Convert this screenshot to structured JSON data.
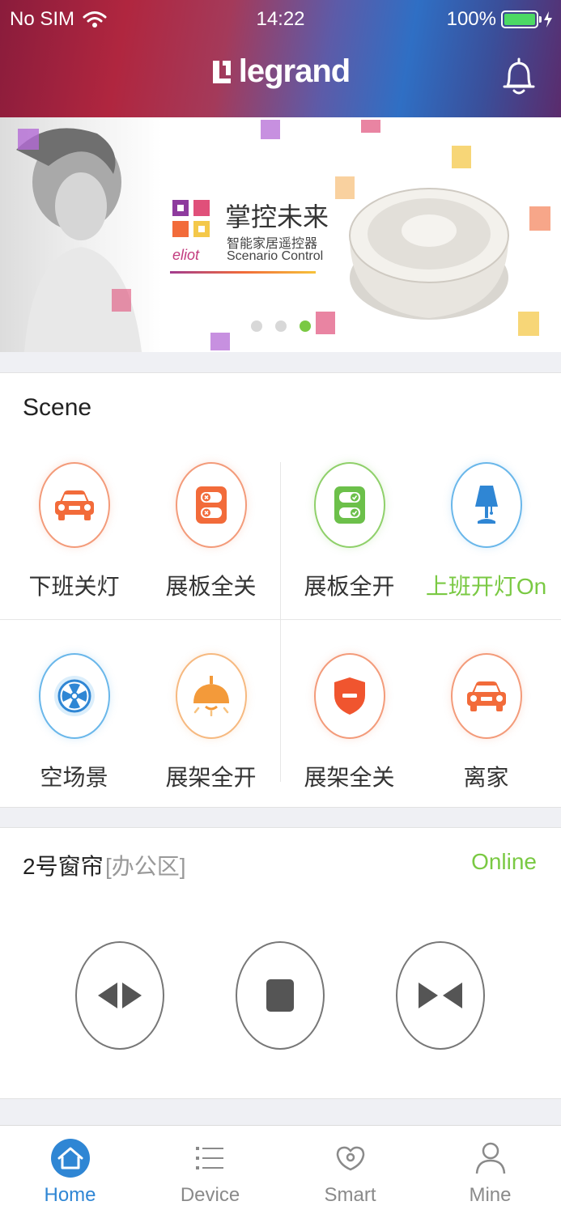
{
  "status_bar": {
    "carrier": "No SIM",
    "time": "14:22",
    "battery": "100%"
  },
  "header": {
    "brand": "legrand"
  },
  "banner": {
    "title_zh": "掌控未来",
    "subtitle_zh": "智能家居遥控器",
    "subtitle_en": "Scenario Control",
    "product_brand": "eliot",
    "pages": 3,
    "active_page": 3
  },
  "scene": {
    "title": "Scene",
    "items": [
      {
        "label": "下班关灯",
        "icon": "car-icon",
        "color": "#f26b3a"
      },
      {
        "label": "展板全关",
        "icon": "switch-panel-off-icon",
        "color": "#f26b3a"
      },
      {
        "label": "展板全开",
        "icon": "switch-panel-on-icon",
        "color": "#6cc04a"
      },
      {
        "label": "上班开灯On",
        "icon": "lamp-icon",
        "color": "#2f86d4",
        "active": true
      },
      {
        "label": "空场景",
        "icon": "fan-icon",
        "color": "#2f86d4"
      },
      {
        "label": "展架全开",
        "icon": "ceiling-light-icon",
        "color": "#f39a3a"
      },
      {
        "label": "展架全关",
        "icon": "shield-icon",
        "color": "#f0552f"
      },
      {
        "label": "离家",
        "icon": "car-icon",
        "color": "#f26b3a"
      }
    ]
  },
  "curtain": {
    "name": "2号窗帘",
    "area": "[办公区]",
    "status": "Online",
    "controls": [
      "open-icon",
      "stop-icon",
      "close-icon"
    ]
  },
  "tabs": [
    {
      "label": "Home",
      "icon": "home-icon",
      "active": true
    },
    {
      "label": "Device",
      "icon": "list-icon"
    },
    {
      "label": "Smart",
      "icon": "smart-icon"
    },
    {
      "label": "Mine",
      "icon": "person-icon"
    }
  ],
  "colors": {
    "accent_green": "#7ac943",
    "accent_blue": "#2f86d4"
  }
}
